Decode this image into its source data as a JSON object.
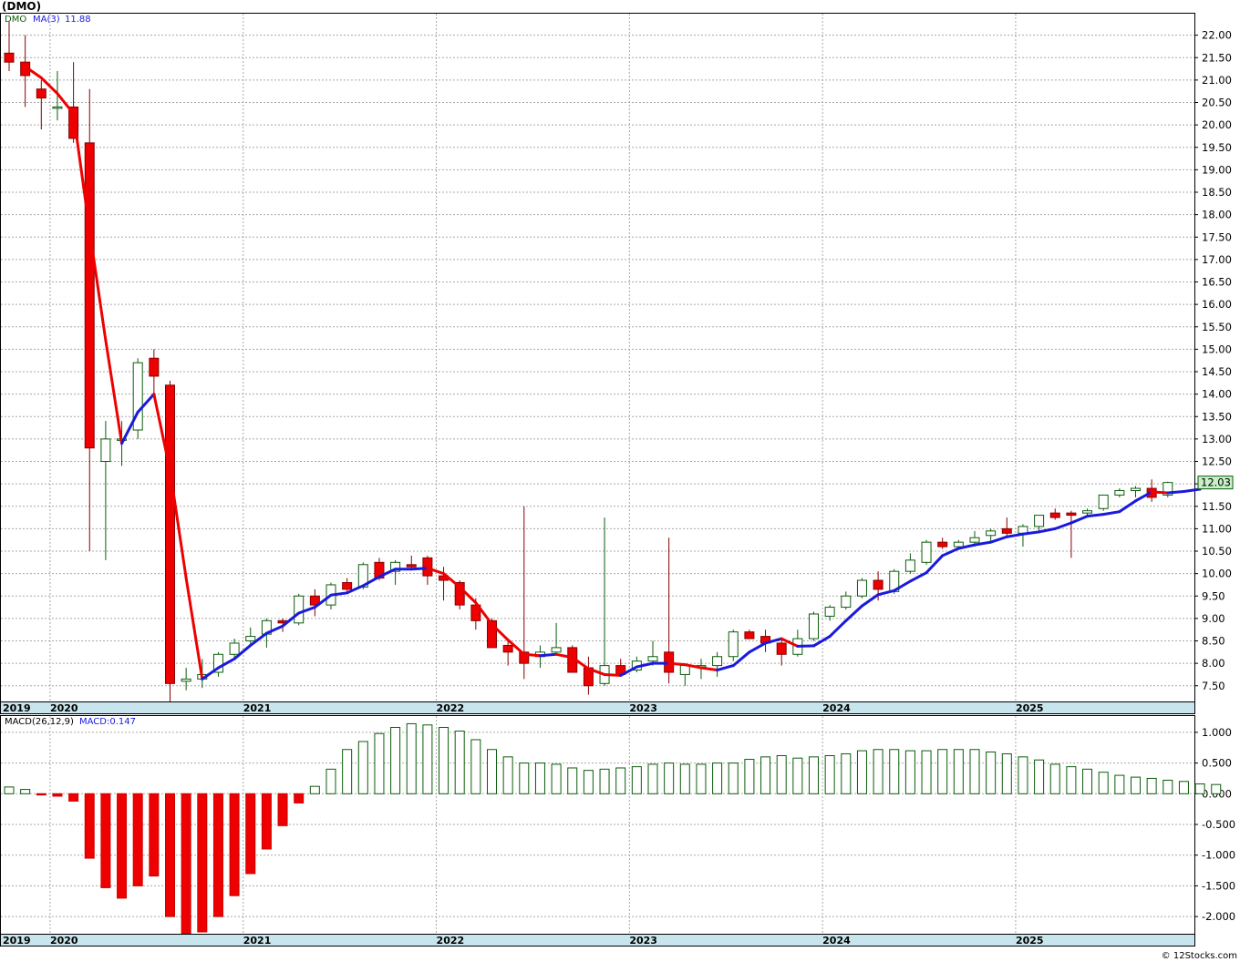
{
  "title": "(DMO)",
  "credit": "© 12Stocks.com",
  "colors": {
    "up": "#0b5d0b",
    "down": "#ee0000",
    "ma_up": "#1a1adc",
    "ma_down": "#ee0000",
    "last_bg": "#c8f0c8",
    "axis_band": "#c8e4ec"
  },
  "years": [
    {
      "label": "2019",
      "x": 0
    },
    {
      "label": "2020",
      "x": 3
    },
    {
      "label": "2021",
      "x": 15
    },
    {
      "label": "2022",
      "x": 27
    },
    {
      "label": "2023",
      "x": 39
    },
    {
      "label": "2024",
      "x": 51
    },
    {
      "label": "2025",
      "x": 63
    }
  ],
  "chart_data": [
    {
      "type": "candlestick",
      "legend": {
        "symbol": "DMO",
        "ma_label": "MA(3)",
        "ma_value": "11.88"
      },
      "last_price": "12.03",
      "ylim": [
        7.15,
        22.5
      ],
      "yticks": [
        7.5,
        8.0,
        8.5,
        9.0,
        9.5,
        10.0,
        10.5,
        11.0,
        11.5,
        12.0,
        12.5,
        13.0,
        13.5,
        14.0,
        14.5,
        15.0,
        15.5,
        16.0,
        16.5,
        17.0,
        17.5,
        18.0,
        18.5,
        19.0,
        19.5,
        20.0,
        20.5,
        21.0,
        21.5,
        22.0
      ],
      "ytick_labels": [
        "7.50",
        "8.00",
        "8.50",
        "9.00",
        "9.50",
        "10.00",
        "10.50",
        "11.00",
        "11.50",
        "12.00",
        "12.50",
        "13.00",
        "13.50",
        "14.00",
        "14.50",
        "15.00",
        "15.50",
        "16.00",
        "16.50",
        "17.00",
        "17.50",
        "18.00",
        "18.50",
        "19.00",
        "19.50",
        "20.00",
        "20.50",
        "21.00",
        "21.50",
        "22.00"
      ],
      "ohlc": [
        [
          21.6,
          22.3,
          21.2,
          21.4
        ],
        [
          21.4,
          22.0,
          20.4,
          21.1
        ],
        [
          20.8,
          21.0,
          19.9,
          20.6
        ],
        [
          20.4,
          21.2,
          20.1,
          20.4
        ],
        [
          20.4,
          21.4,
          19.6,
          19.7
        ],
        [
          19.6,
          20.8,
          10.5,
          12.8
        ],
        [
          12.5,
          13.4,
          10.3,
          13.0
        ],
        [
          13.0,
          13.4,
          12.4,
          13.0
        ],
        [
          13.2,
          14.8,
          13.0,
          14.7
        ],
        [
          14.8,
          15.0,
          13.9,
          14.4
        ],
        [
          14.2,
          14.3,
          7.1,
          7.55
        ],
        [
          7.6,
          7.9,
          7.4,
          7.65
        ],
        [
          7.65,
          8.1,
          7.45,
          7.75
        ],
        [
          7.8,
          8.25,
          7.7,
          8.2
        ],
        [
          8.2,
          8.55,
          8.1,
          8.45
        ],
        [
          8.5,
          8.8,
          8.4,
          8.6
        ],
        [
          8.65,
          9.0,
          8.35,
          8.95
        ],
        [
          8.95,
          9.0,
          8.7,
          8.9
        ],
        [
          8.9,
          9.55,
          8.85,
          9.5
        ],
        [
          9.5,
          9.65,
          9.05,
          9.3
        ],
        [
          9.3,
          9.8,
          9.2,
          9.75
        ],
        [
          9.8,
          9.9,
          9.6,
          9.65
        ],
        [
          9.7,
          10.25,
          9.65,
          10.2
        ],
        [
          10.25,
          10.35,
          9.85,
          9.9
        ],
        [
          10.05,
          10.3,
          9.75,
          10.25
        ],
        [
          10.2,
          10.4,
          10.1,
          10.15
        ],
        [
          10.35,
          10.4,
          9.75,
          9.95
        ],
        [
          9.95,
          10.15,
          9.4,
          9.85
        ],
        [
          9.8,
          9.85,
          9.2,
          9.3
        ],
        [
          9.3,
          9.45,
          8.75,
          8.95
        ],
        [
          8.95,
          9.0,
          8.35,
          8.35
        ],
        [
          8.4,
          8.5,
          7.95,
          8.25
        ],
        [
          8.25,
          11.5,
          7.65,
          8.0
        ],
        [
          8.15,
          8.4,
          7.9,
          8.25
        ],
        [
          8.25,
          8.9,
          8.2,
          8.35
        ],
        [
          8.35,
          8.4,
          7.8,
          7.8
        ],
        [
          7.9,
          8.15,
          7.3,
          7.5
        ],
        [
          7.55,
          11.25,
          7.5,
          7.95
        ],
        [
          7.95,
          8.1,
          7.75,
          7.75
        ],
        [
          7.85,
          8.15,
          7.8,
          8.05
        ],
        [
          8.05,
          8.5,
          7.95,
          8.15
        ],
        [
          8.25,
          10.8,
          7.55,
          7.8
        ],
        [
          7.75,
          8.0,
          7.5,
          7.95
        ],
        [
          7.95,
          8.1,
          7.65,
          7.95
        ],
        [
          7.95,
          8.25,
          7.7,
          8.15
        ],
        [
          8.15,
          8.75,
          8.05,
          8.7
        ],
        [
          8.7,
          8.75,
          8.55,
          8.55
        ],
        [
          8.6,
          8.75,
          8.25,
          8.45
        ],
        [
          8.45,
          8.55,
          7.95,
          8.2
        ],
        [
          8.2,
          8.75,
          8.15,
          8.55
        ],
        [
          8.55,
          9.15,
          8.5,
          9.1
        ],
        [
          9.05,
          9.3,
          8.95,
          9.25
        ],
        [
          9.25,
          9.6,
          9.2,
          9.5
        ],
        [
          9.5,
          9.9,
          9.45,
          9.85
        ],
        [
          9.85,
          10.05,
          9.4,
          9.65
        ],
        [
          9.6,
          10.1,
          9.55,
          10.05
        ],
        [
          10.05,
          10.45,
          10.0,
          10.3
        ],
        [
          10.25,
          10.75,
          10.2,
          10.7
        ],
        [
          10.7,
          10.8,
          10.55,
          10.6
        ],
        [
          10.6,
          10.75,
          10.55,
          10.7
        ],
        [
          10.7,
          10.95,
          10.6,
          10.8
        ],
        [
          10.85,
          11.0,
          10.7,
          10.95
        ],
        [
          11.0,
          11.25,
          10.85,
          10.9
        ],
        [
          10.9,
          11.1,
          10.6,
          11.05
        ],
        [
          11.05,
          11.3,
          10.95,
          11.3
        ],
        [
          11.35,
          11.45,
          11.2,
          11.25
        ],
        [
          11.35,
          11.4,
          10.35,
          11.3
        ],
        [
          11.35,
          11.45,
          11.25,
          11.4
        ],
        [
          11.45,
          11.75,
          11.4,
          11.75
        ],
        [
          11.75,
          11.9,
          11.7,
          11.85
        ],
        [
          11.85,
          11.95,
          11.7,
          11.9
        ],
        [
          11.9,
          12.1,
          11.6,
          11.7
        ],
        [
          11.75,
          12.05,
          11.7,
          12.03
        ]
      ],
      "ma": [
        null,
        21.3,
        21.05,
        20.7,
        20.25,
        17.65,
        15.2,
        12.9,
        13.6,
        14.0,
        12.3,
        9.9,
        7.65,
        7.9,
        8.1,
        8.4,
        8.67,
        8.83,
        9.12,
        9.25,
        9.52,
        9.57,
        9.73,
        9.93,
        10.1,
        10.1,
        10.12,
        10.0,
        9.7,
        9.35,
        8.87,
        8.52,
        8.2,
        8.17,
        8.2,
        8.13,
        7.88,
        7.75,
        7.73,
        7.92,
        8.0,
        8.0,
        7.97,
        7.9,
        7.85,
        7.95,
        8.25,
        8.45,
        8.55,
        8.38,
        8.39,
        8.6,
        8.95,
        9.28,
        9.53,
        9.62,
        9.83,
        10.02,
        10.4,
        10.56,
        10.64,
        10.7,
        10.82,
        10.88,
        10.93,
        11.0,
        11.13,
        11.28,
        11.32,
        11.38,
        11.62,
        11.82,
        11.8,
        11.83,
        11.88
      ]
    },
    {
      "type": "bar",
      "legend": {
        "name": "MACD(26,12,9)",
        "value_label": "MACD:0.147"
      },
      "ylim": [
        -2.28,
        1.28
      ],
      "yticks": [
        -2.0,
        -1.5,
        -1.0,
        -0.5,
        0.0,
        0.5,
        1.0
      ],
      "ytick_labels": [
        "-2.000",
        "-1.500",
        "-1.000",
        "-0.500",
        "0.000",
        "0.500",
        "1.000"
      ],
      "values": [
        0.11,
        0.07,
        -0.02,
        -0.04,
        -0.12,
        -1.05,
        -1.53,
        -1.7,
        -1.5,
        -1.34,
        -2.0,
        -2.28,
        -2.25,
        -2.0,
        -1.66,
        -1.3,
        -0.9,
        -0.52,
        -0.15,
        0.12,
        0.4,
        0.72,
        0.85,
        0.98,
        1.08,
        1.14,
        1.12,
        1.08,
        1.02,
        0.88,
        0.72,
        0.6,
        0.5,
        0.5,
        0.48,
        0.42,
        0.38,
        0.4,
        0.42,
        0.44,
        0.48,
        0.5,
        0.48,
        0.48,
        0.5,
        0.5,
        0.56,
        0.6,
        0.62,
        0.58,
        0.6,
        0.62,
        0.65,
        0.7,
        0.72,
        0.72,
        0.7,
        0.7,
        0.72,
        0.72,
        0.72,
        0.68,
        0.65,
        0.6,
        0.55,
        0.48,
        0.44,
        0.4,
        0.35,
        0.3,
        0.27,
        0.25,
        0.22,
        0.2,
        0.16,
        0.15
      ]
    }
  ]
}
